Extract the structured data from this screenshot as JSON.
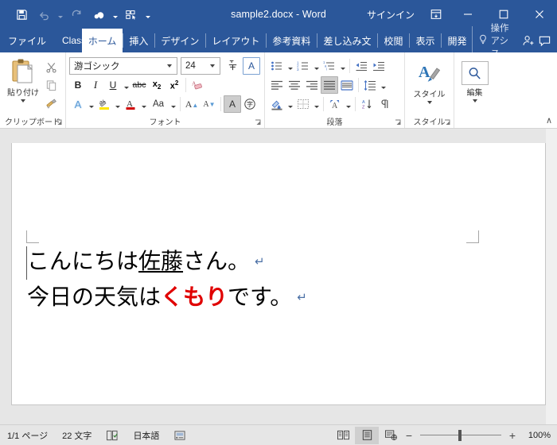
{
  "titlebar": {
    "title": "sample2.docx - Word",
    "signin": "サインイン",
    "qat": [
      {
        "name": "save-icon",
        "label": "上書き保存"
      },
      {
        "name": "undo-icon",
        "label": "元に戻す"
      },
      {
        "name": "redo-icon",
        "label": "やり直し"
      },
      {
        "name": "touch-mode-icon",
        "label": "タッチ/マウス モードの切り替え"
      },
      {
        "name": "classic-menu-icon",
        "label": "Classic Menu"
      },
      {
        "name": "customize-qat-icon",
        "label": "クイック アクセス ツール バーのユーザー設定"
      }
    ],
    "window": {
      "minimize": "—",
      "maximize": "☐",
      "close": "✕",
      "ribbon_display": "ribbon-display-options-icon"
    }
  },
  "tabs": [
    {
      "label": "ファイル",
      "active": false
    },
    {
      "label": "Classic Me",
      "active": false
    },
    {
      "label": "ホーム",
      "active": true
    },
    {
      "label": "挿入",
      "active": false
    },
    {
      "label": "デザイン",
      "active": false
    },
    {
      "label": "レイアウト",
      "active": false
    },
    {
      "label": "参考資料",
      "active": false
    },
    {
      "label": "差し込み文",
      "active": false
    },
    {
      "label": "校閲",
      "active": false
    },
    {
      "label": "表示",
      "active": false
    },
    {
      "label": "開発",
      "active": false
    }
  ],
  "tellme": {
    "label": "操作アシス",
    "icon": "lightbulb-icon"
  },
  "account_icon": "account-person-icon",
  "comments_icon": "comments-balloon-icon",
  "ribbon": {
    "collapse_label": "∧",
    "groups": [
      {
        "name": "clipboard",
        "label": "クリップボード",
        "paste_label": "貼り付け",
        "buttons": [
          "cut-scissors-icon",
          "copy-icon",
          "format-painter-icon"
        ]
      },
      {
        "name": "font",
        "label": "フォント",
        "font_name": "游ゴシック",
        "font_size": "24",
        "buttons": [
          "bold-icon",
          "italic-icon",
          "underline-icon",
          "strikethrough-icon",
          "subscript-icon",
          "superscript-icon",
          "clear-formatting-icon",
          "text-effects-icon",
          "text-highlight-color-icon",
          "font-color-icon",
          "change-case-icon",
          "grow-font-icon",
          "shrink-font-icon",
          "character-shading-icon",
          "enclose-character-icon",
          "phonetic-guide-icon",
          "character-border-icon"
        ]
      },
      {
        "name": "paragraph",
        "label": "段落",
        "buttons": [
          "bullets-icon",
          "numbering-icon",
          "multilevel-list-icon",
          "decrease-indent-icon",
          "increase-indent-icon",
          "align-left-icon",
          "align-center-icon",
          "align-right-icon",
          "justify-icon",
          "distributed-icon",
          "line-spacing-icon",
          "shading-icon",
          "borders-icon",
          "asian-layout-icon",
          "sort-icon",
          "show-formatting-marks-icon"
        ],
        "selected": "justify-icon"
      },
      {
        "name": "styles",
        "label": "スタイル",
        "button_label": "スタイル",
        "icon": "styles-brush-icon"
      },
      {
        "name": "editing",
        "label": "",
        "button_label": "編集",
        "icon": "find-magnifier-icon"
      }
    ]
  },
  "document": {
    "lines": [
      {
        "segments": [
          {
            "text": "こんにちは",
            "style": "normal"
          },
          {
            "text": "佐藤",
            "style": "underline"
          },
          {
            "text": "さん。",
            "style": "normal"
          }
        ],
        "pilcrow": "↵"
      },
      {
        "segments": [
          {
            "text": "今日の天気は",
            "style": "normal"
          },
          {
            "text": "くもり",
            "style": "bold-red"
          },
          {
            "text": "です。",
            "style": "normal"
          }
        ],
        "pilcrow": "↵"
      }
    ],
    "highlight_color": "#e00000"
  },
  "statusbar": {
    "page": "1/1 ページ",
    "chars": "22 文字",
    "proofing_icon": "proofing-errors-icon",
    "language": "日本語",
    "macro_icon": "macro-record-icon",
    "views": [
      {
        "name": "read-mode-view-icon",
        "selected": false
      },
      {
        "name": "print-layout-view-icon",
        "selected": true
      },
      {
        "name": "web-layout-view-icon",
        "selected": false
      }
    ],
    "zoom_out": "−",
    "zoom_in": "+",
    "zoom_value": "100%"
  }
}
